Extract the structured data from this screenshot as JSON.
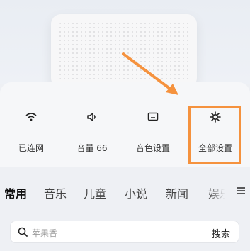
{
  "controls": [
    {
      "label": "已连网",
      "icon": "wifi-icon"
    },
    {
      "label": "音量 66",
      "icon": "volume-icon"
    },
    {
      "label": "音色设置",
      "icon": "tone-settings-icon"
    },
    {
      "label": "全部设置",
      "icon": "gear-icon"
    }
  ],
  "tabs": [
    "常用",
    "音乐",
    "儿童",
    "小说",
    "新闻",
    "娱乐"
  ],
  "active_tab": "常用",
  "search": {
    "placeholder": "苹果香",
    "button": "搜索"
  },
  "colors": {
    "highlight": "#f5923e",
    "background": "#eef0f4"
  }
}
